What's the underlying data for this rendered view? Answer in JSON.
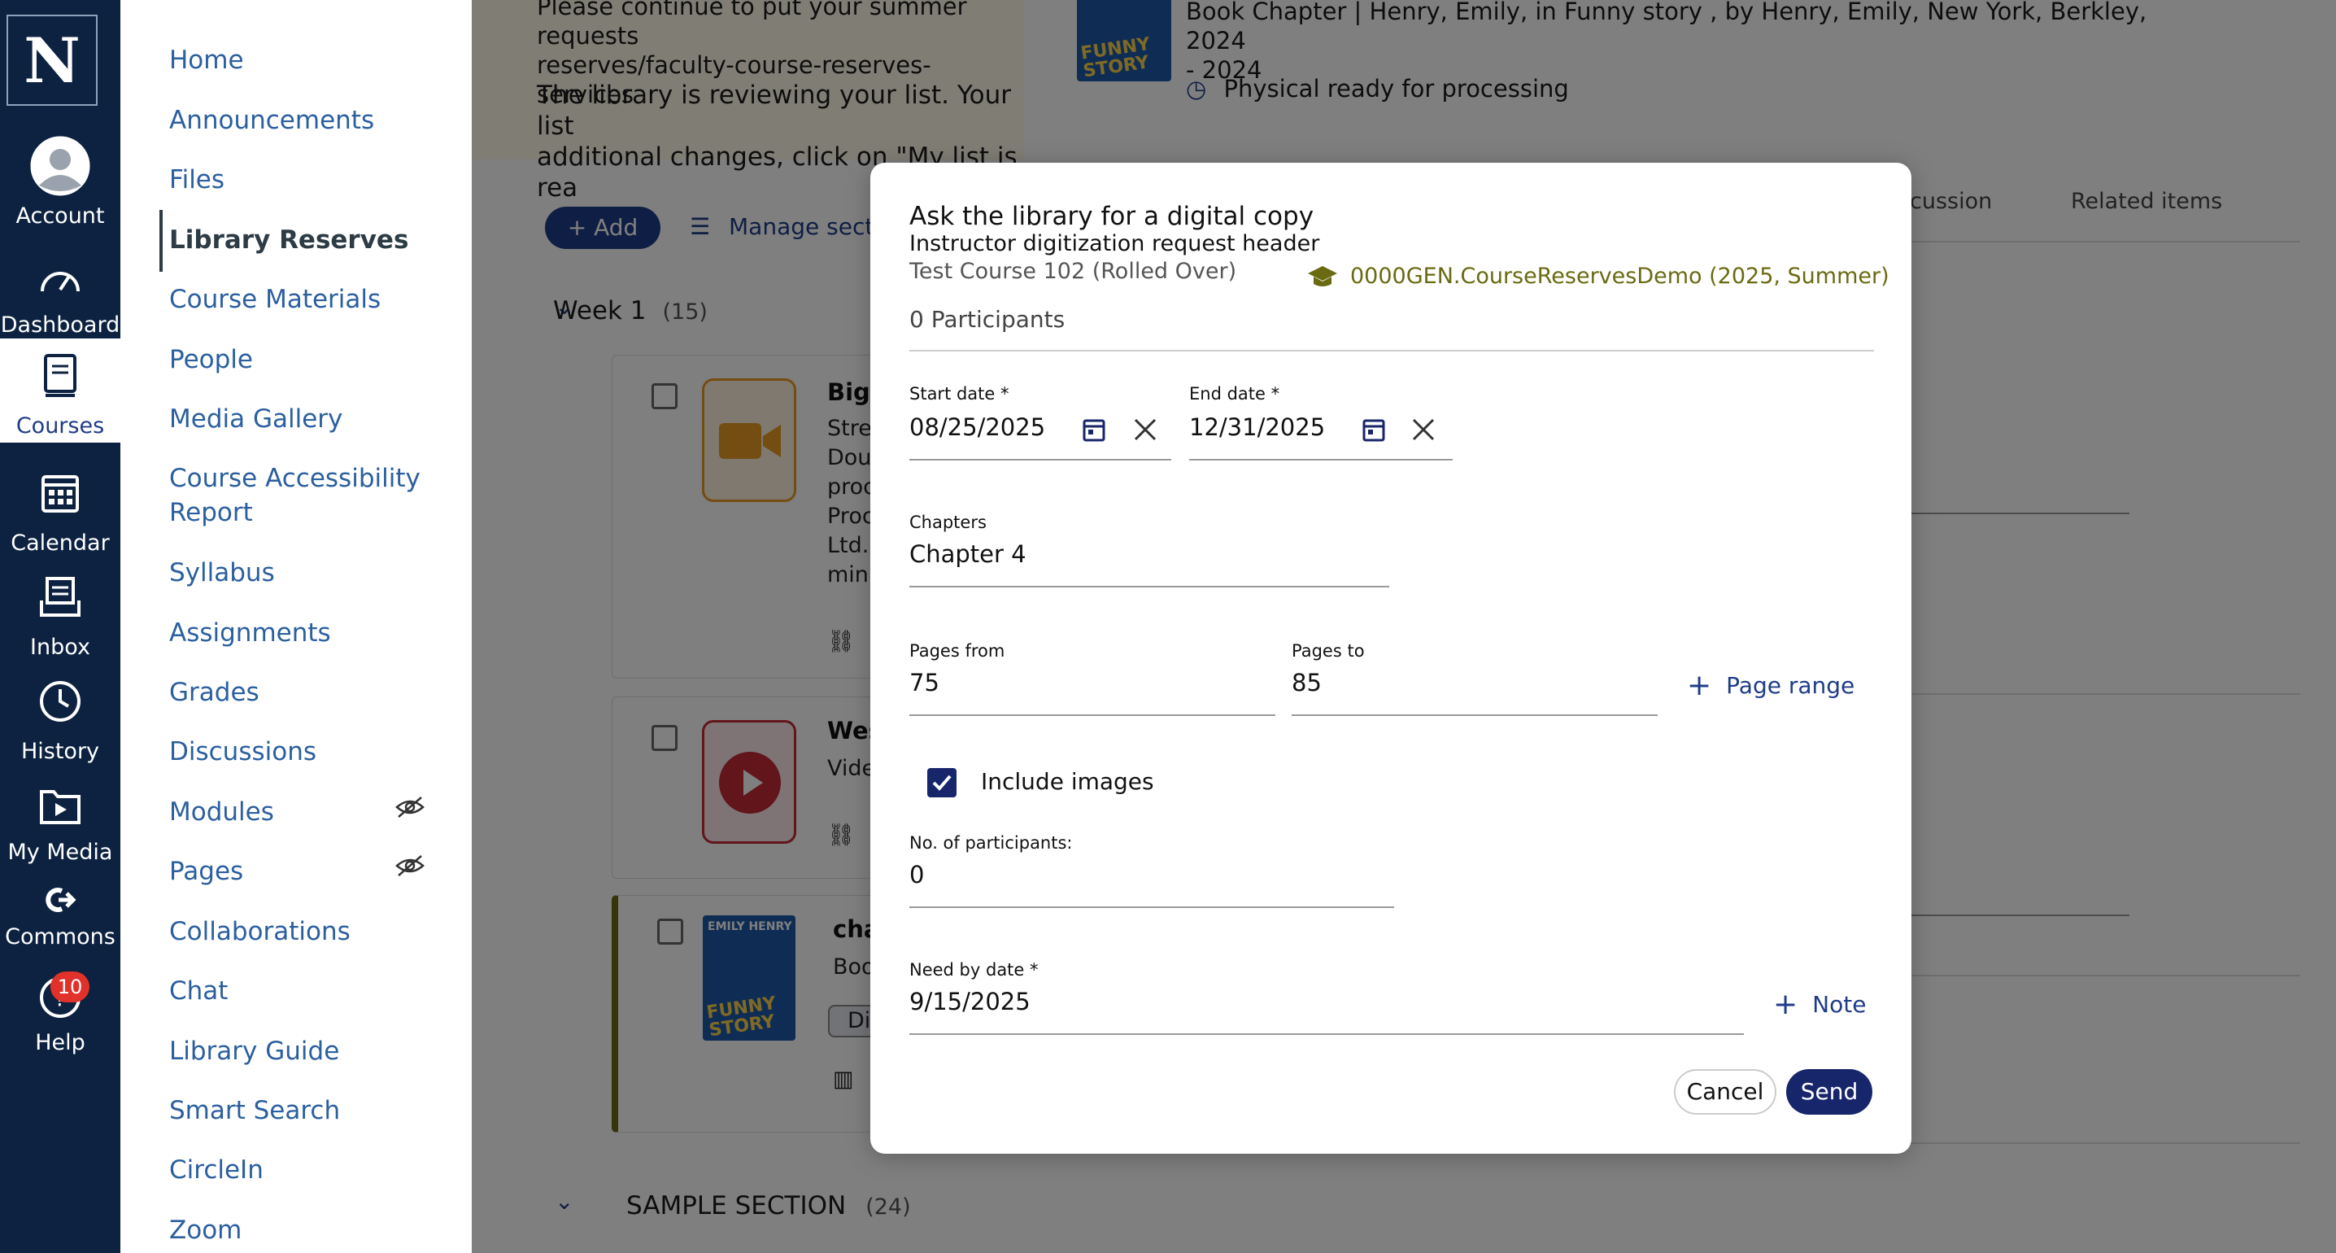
{
  "global_nav": {
    "logo": "N",
    "items": [
      {
        "label": "Account",
        "icon": "avatar-icon"
      },
      {
        "label": "Dashboard",
        "icon": "speedometer-icon"
      },
      {
        "label": "Courses",
        "icon": "book-icon"
      },
      {
        "label": "Calendar",
        "icon": "calendar-icon"
      },
      {
        "label": "Inbox",
        "icon": "inbox-icon"
      },
      {
        "label": "History",
        "icon": "clock-icon"
      },
      {
        "label": "My Media",
        "icon": "media-folder-icon"
      },
      {
        "label": "Commons",
        "icon": "commons-icon"
      },
      {
        "label": "Help",
        "icon": "help-icon"
      }
    ],
    "help_badge": "10"
  },
  "course_nav": {
    "items": [
      "Home",
      "Announcements",
      "Files",
      "Library Reserves",
      "Course Materials",
      "People",
      "Media Gallery",
      "Course Accessibility",
      "Report",
      "Syllabus",
      "Assignments",
      "Grades",
      "Discussions",
      "Modules",
      "Pages",
      "Collaborations",
      "Chat",
      "Library Guide",
      "Smart Search",
      "CircleIn",
      "Zoom"
    ],
    "active": "Library Reserves"
  },
  "background": {
    "banner_line1": "Please continue to put your summer requests",
    "banner_line2": "reserves/faculty-course-reserves-services",
    "banner_msg": "The library is reviewing your list. Your list",
    "banner_msg2": "additional changes, click on \"My list is rea",
    "add_label": "+ Add",
    "manage_label": "Manage secti",
    "week_label": "Week 1",
    "week_count": "(15)",
    "card1_title": "Big",
    "card1_lines": [
      "Stre",
      "Dou",
      "proc",
      "Proc",
      "Ltd.,",
      "minu"
    ],
    "card2_title": "Wes",
    "card2_line": "Vide",
    "card3_title": "cha",
    "card3_line": "Boo",
    "card3_tag": "Di",
    "section_label": "SAMPLE SECTION",
    "section_count": "(24)",
    "book_header": "EMILY HENRY",
    "book_title": "FUNNY STORY"
  },
  "right_pane": {
    "title_line1": "Book Chapter  |  Henry, Emily, in Funny story , by Henry, Emily, New York, Berkley, 2024",
    "title_line2": "- 2024",
    "status": "Physical ready for processing",
    "tab_discussion": "cussion",
    "tab_related": "Related items"
  },
  "modal": {
    "title": "Ask the library for a digital copy",
    "subtitle": "Instructor digitization request header",
    "course": "Test Course 102 (Rolled Over)",
    "course_code": "0000GEN.CourseReservesDemo (2025, Summer)",
    "participants": "0 Participants",
    "start_label": "Start date *",
    "start_value": "08/25/2025",
    "end_label": "End date *",
    "end_value": "12/31/2025",
    "chapters_label": "Chapters",
    "chapters_value": "Chapter 4",
    "pages_from_label": "Pages from",
    "pages_from_value": "75",
    "pages_to_label": "Pages to",
    "pages_to_value": "85",
    "page_range_label": "Page range",
    "include_images_label": "Include images",
    "include_images_checked": true,
    "num_participants_label": "No. of participants:",
    "num_participants_value": "0",
    "need_by_label": "Need by date *",
    "need_by_value": "9/15/2025",
    "note_label": "Note",
    "cancel_label": "Cancel",
    "send_label": "Send"
  },
  "colors": {
    "nav_bg": "#0d2240",
    "accent": "#17256b",
    "link": "#2b5f9f",
    "course_code": "#6a6a12"
  }
}
